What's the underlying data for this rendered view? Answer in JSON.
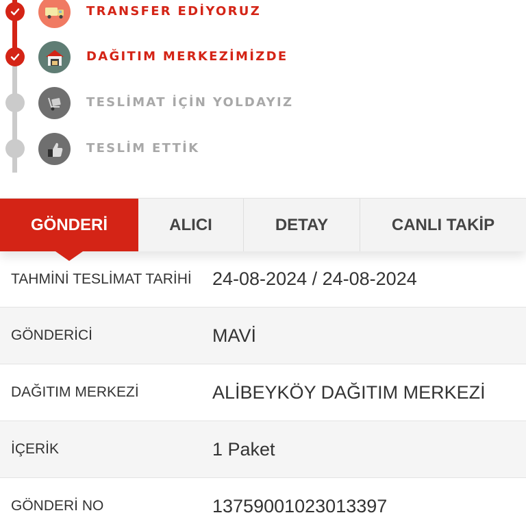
{
  "timeline": {
    "steps": [
      {
        "label": "TRANSFER EDİYORUZ",
        "state": "done",
        "icon": "truck-icon"
      },
      {
        "label": "DAĞITIM MERKEZİMİZDE",
        "state": "done",
        "icon": "warehouse-icon"
      },
      {
        "label": "TESLİMAT İÇİN YOLDAYIZ",
        "state": "pending",
        "icon": "delivery-cart-icon"
      },
      {
        "label": "TESLİM ETTİK",
        "state": "pending",
        "icon": "thumbs-up-icon"
      }
    ]
  },
  "tabs": [
    {
      "label": "GÖNDERİ",
      "active": true
    },
    {
      "label": "ALICI",
      "active": false
    },
    {
      "label": "DETAY",
      "active": false
    },
    {
      "label": "CANLI TAKİP",
      "active": false
    }
  ],
  "details": [
    {
      "key": "TAHMİNİ TESLİMAT TARİHİ",
      "value": "24-08-2024 / 24-08-2024"
    },
    {
      "key": "GÖNDERİCİ",
      "value": "MAVİ"
    },
    {
      "key": "DAĞITIM MERKEZİ",
      "value": "ALİBEYKÖY DAĞITIM MERKEZİ"
    },
    {
      "key": "İÇERİK",
      "value": "1 Paket"
    },
    {
      "key": "GÖNDERİ NO",
      "value": "13759001023013397"
    }
  ],
  "colors": {
    "accent": "#d42416",
    "inactive_dot": "#cbcbcb",
    "inactive_text": "#a8a8a8"
  }
}
